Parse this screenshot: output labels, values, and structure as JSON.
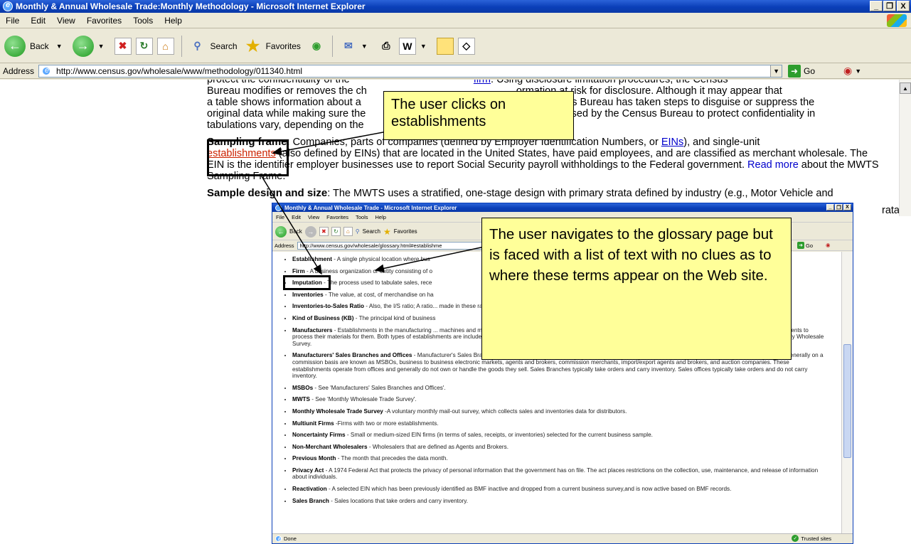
{
  "main": {
    "title": "Monthly & Annual Wholesale Trade:Monthly Methodology - Microsoft Internet Explorer",
    "window_buttons": [
      "_",
      "❐",
      "X"
    ],
    "menu": [
      "File",
      "Edit",
      "View",
      "Favorites",
      "Tools",
      "Help"
    ],
    "toolbar": {
      "back": "Back",
      "search": "Search",
      "favorites": "Favorites"
    },
    "address_label": "Address",
    "url": "http://www.census.gov/wholesale/www/methodology/011340.html",
    "go": "Go",
    "p1_partial": "protect the confidentiality of the",
    "p1_link": "firm",
    "p1_tail": ". Using disclosure limitation procedures, the Census",
    "p1_line2": "Bureau modifies or removes the ch",
    "p1_line2b": "ormation at risk for disclosure. Although it may appear that",
    "p1_line3": "a table shows information about a",
    "p1_line3b": "ensus Bureau has taken steps to disguise or suppress the",
    "p1_line4": "original data while making sure the",
    "p1_line4b": "es used by the Census Bureau to protect confidentiality in",
    "p1_line5": "tabulations vary, depending on the",
    "p2_term": "Sampling frame",
    "p2_a": ": Companies, parts of companies (defined by Employer Identification Numbers, or ",
    "p2_ein": "EINs",
    "p2_b": "), and single-unit",
    "p2_link": "establishments",
    "p2_c": " (also defined by EINs) that are located in the United States, have paid employees, and are classified as merchant wholesale. The EIN is the identifier employer businesses use to report Social Security payroll withholdings to the Federal government. ",
    "p2_readmore": "Read more",
    "p2_d": " about the MWTS Sampling Frame.",
    "p3_term": "Sample design and size",
    "p3_a": ": The MWTS uses a stratified, one-stage design with primary strata defined by industry (e.g., Motor Vehicle and",
    "p3_tail": "rata"
  },
  "glossary": {
    "title": "Monthly & Annual Wholesale Trade - Microsoft Internet Explorer",
    "menu": [
      "File",
      "Edit",
      "View",
      "Favorites",
      "Tools",
      "Help"
    ],
    "toolbar": {
      "back": "Back",
      "search": "Search",
      "favorites": "Favorites"
    },
    "address_label": "Address",
    "url": "http://www.census.gov/wholesale/glossary.html#establishme",
    "go": "Go",
    "status": "Done",
    "zone": "Trusted sites",
    "items": [
      {
        "term": "Establishment",
        "text": " - A single physical location where bus"
      },
      {
        "term": "Firm",
        "text": " - A business organization or entity consisting of o"
      },
      {
        "term": "Imputation",
        "text": " - The process used to tabulate sales, rece"
      },
      {
        "term": "Inventories",
        "text": " - The value, at cost, of merchandise on ha"
      },
      {
        "term": "Inventories-to-Sales Ratio",
        "text": " - Also, the I/S ratio; A ratio... made in these ratios for the markup in sales which may"
      },
      {
        "term": "Kind of Business (KB)",
        "text": " - The principal kind of business"
      },
      {
        "term": "Manufacturers",
        "text": " - Establishments in the manufacturing ... machines and material-handling equipment. Manufacturing establishments may process materials, or may contract with other establishments to process their materials for them. Both types of establishments are included in manufacturing. Firms that domestically manufacture the products that they wholesale are not in-scope for the Monthly Wholesale Survey."
      },
      {
        "term": "Manufacturers' Sales Branches and Offices",
        "text": " - Manufacturer's Sales Branches and Offices; Establishments arranging for the purchase or sale of goods owned by others or purchasing goods, generally on a commission basis are known as MSBOs, business to business electronic markets, agents and brokers, commission merchants, import/export agents and brokers, and auction companies. These establishments operate from offices and generally do not own or handle the goods they sell. Sales Branches typically take orders and carry inventory. Sales offices typically take orders and do not carry inventory."
      },
      {
        "term": "MSBOs",
        "text": " - See 'Manufacturers' Sales Branches and Offices'."
      },
      {
        "term": "MWTS",
        "text": " - See 'Monthly Wholesale Trade Survey'."
      },
      {
        "term": "Monthly Wholesale Trade Survey",
        "text": " -A voluntary monthly mail-out survey, which collects sales and inventories data for distributors."
      },
      {
        "term": "Multiunit Firms",
        "text": " -Firms with two or more establishments."
      },
      {
        "term": "Noncertainty Firms",
        "text": " - Small or medium-sized EIN firms (in terms of sales, receipts, or inventories) selected for the current business sample."
      },
      {
        "term": "Non-Merchant Wholesalers",
        "text": " - Wholesalers that are defined as Agents and Brokers."
      },
      {
        "term": "Previous Month",
        "text": " - The month that precedes the data month."
      },
      {
        "term": "Privacy Act",
        "text": " - A 1974 Federal Act that protects the privacy of personal information that the government has on file. The act places restrictions on the collection, use, maintenance, and release of information about individuals."
      },
      {
        "term": "Reactivation",
        "text": " - A selected EIN which has been previously identified as BMF inactive and dropped from a current business survey,and is now active based on BMF records."
      },
      {
        "term": "Sales Branch",
        "text": " - Sales locations that take orders and carry inventory."
      }
    ]
  },
  "annotations": {
    "callout_1": "The user clicks on establishments",
    "callout_2": "The user navigates to the glossary page but is faced with a list of text with no clues as to where these terms appear on the Web site."
  }
}
